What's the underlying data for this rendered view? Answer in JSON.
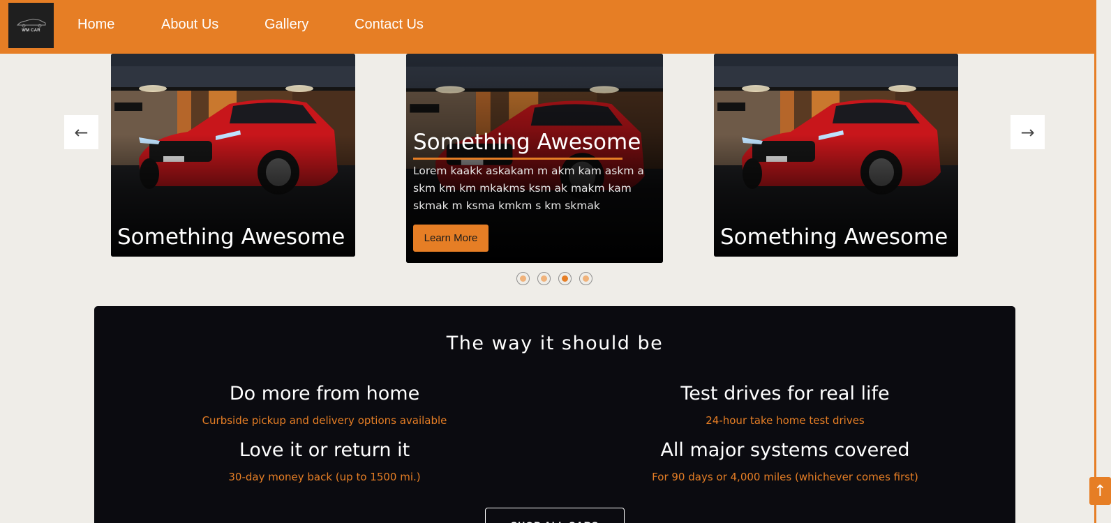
{
  "brand": {
    "logo_text": "WM CAR",
    "accent_color": "#e67e25",
    "header_color": "#e67e25",
    "panel_color": "#0b0b10"
  },
  "nav": {
    "items": [
      {
        "label": "Home"
      },
      {
        "label": "About Us"
      },
      {
        "label": "Gallery"
      },
      {
        "label": "Contact Us"
      }
    ]
  },
  "carousel": {
    "prev_icon": "←",
    "next_icon": "→",
    "slides": [
      {
        "title": "Something Awesome"
      },
      {
        "title": "Something Awesome",
        "description": "Lorem kaakk askakam m akm kam askm a skm km km mkakms ksm ak makm kam skmak m ksma kmkm s km skmak",
        "button_label": "Learn More"
      },
      {
        "title": "Something Awesome"
      }
    ],
    "dot_count": 4,
    "active_dot": 3
  },
  "features": {
    "heading": "The way it should be",
    "items": [
      {
        "title": "Do more from home",
        "subtitle": "Curbside pickup and delivery options available"
      },
      {
        "title": "Test drives for real life",
        "subtitle": "24-hour take home test drives"
      },
      {
        "title": "Love it or return it",
        "subtitle": "30-day money back (up to 1500 mi.)"
      },
      {
        "title": "All major systems covered",
        "subtitle": "For 90 days or 4,000 miles (whichever comes first)"
      }
    ],
    "cta_label": "SHOP ALL CARS"
  },
  "back_to_top_icon": "↑"
}
